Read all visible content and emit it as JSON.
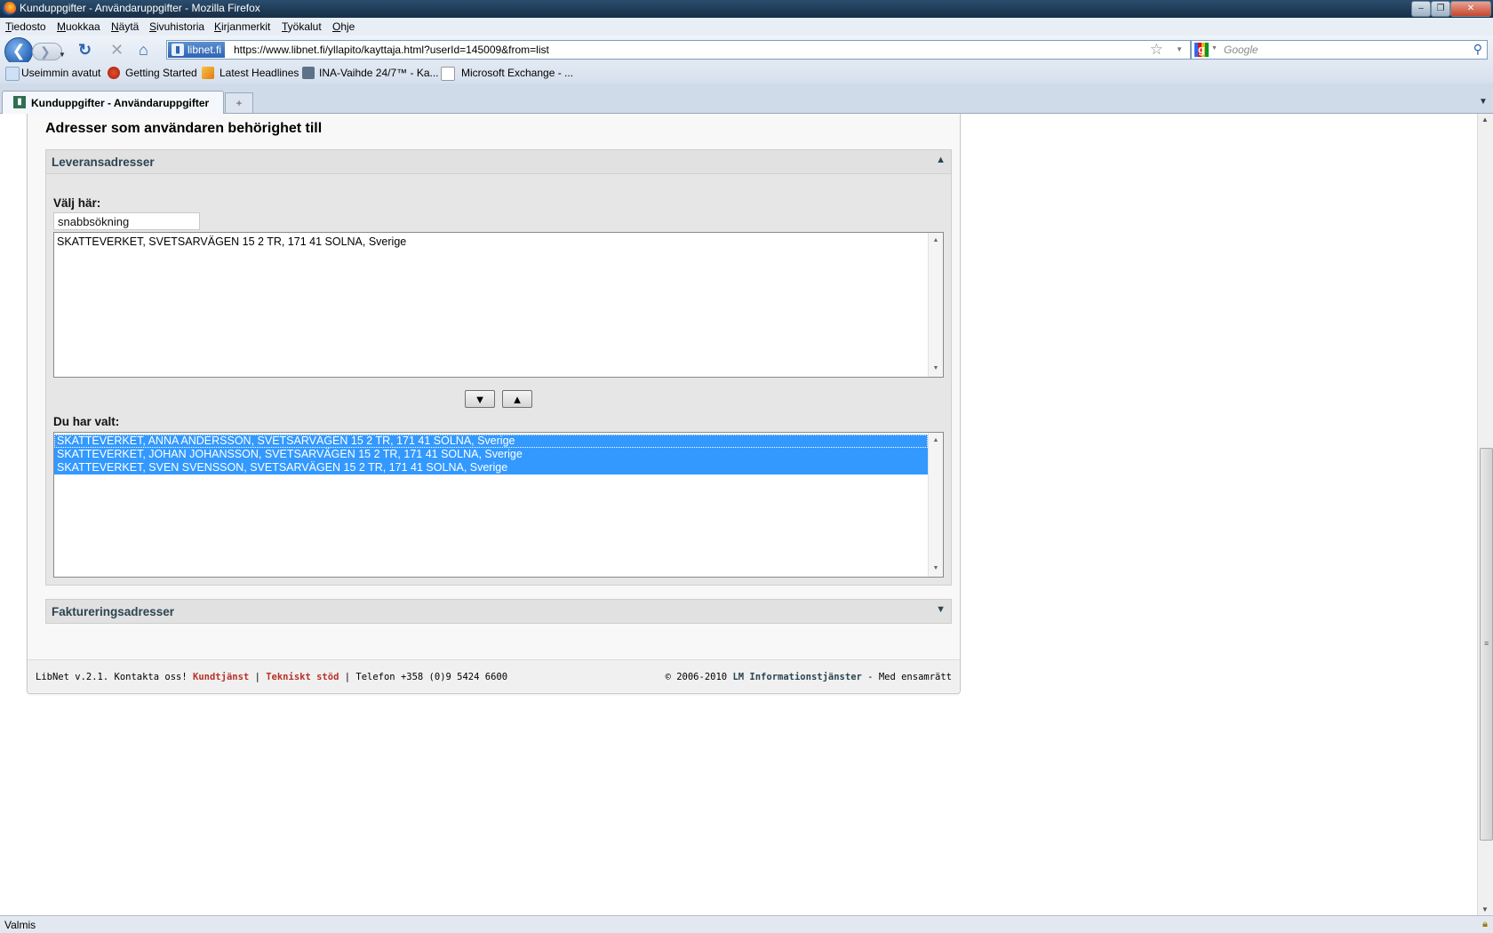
{
  "window": {
    "title": "Kunduppgifter - Användaruppgifter - Mozilla Firefox"
  },
  "menu": [
    "Tiedosto",
    "Muokkaa",
    "Näytä",
    "Sivuhistoria",
    "Kirjanmerkit",
    "Työkalut",
    "Ohje"
  ],
  "nav": {
    "site_badge": "libnet.fi",
    "url": "https://www.libnet.fi/yllapito/kayttaja.html?userId=145009&from=list",
    "search_placeholder": "Google"
  },
  "bookmarks": [
    "Useimmin avatut",
    "Getting Started",
    "Latest Headlines",
    "INA-Vaihde 24/7™ - Ka...",
    "Microsoft Exchange - ..."
  ],
  "tabs": [
    {
      "label": "Kunduppgifter - Användaruppgifter",
      "active": true
    }
  ],
  "page": {
    "heading": "Adresser som användaren behörighet till",
    "delivery": {
      "title": "Leveransadresser",
      "choose_label": "Välj här:",
      "quick_search_value": "snabbsökning",
      "available": [
        "SKATTEVERKET, SVETSARVÄGEN 15 2 TR, 171 41 SOLNA, Sverige"
      ],
      "move_down_label": "▼",
      "move_up_label": "▲",
      "selected_label": "Du har valt:",
      "selected": [
        "SKATTEVERKET, ANNA ANDERSSON, SVETSARVÄGEN 15 2 TR, 171 41 SOLNA, Sverige",
        "SKATTEVERKET, JOHAN JOHANSSON, SVETSARVÄGEN 15 2 TR, 171 41 SOLNA, Sverige",
        "SKATTEVERKET, SVEN SVENSSON, SVETSARVÄGEN 15 2 TR, 171 41 SOLNA, Sverige"
      ]
    },
    "billing": {
      "title": "Faktureringsadresser"
    },
    "footer": {
      "left_text": "LibNet v.2.1. Kontakta oss!",
      "link_customer_service": "Kundtjänst",
      "sep1": "|",
      "link_tech_support": "Tekniskt stöd",
      "phone": "| Telefon +358 (0)9 5424 6600",
      "copyright": "© 2006-2010",
      "company": "LM Informationstjänster",
      "rights": "- Med ensamrätt"
    }
  },
  "status": {
    "text": "Valmis"
  },
  "colors": {
    "selection": "#3399ff",
    "panel_title": "#2c4452",
    "footer_link": "#b8322a"
  }
}
